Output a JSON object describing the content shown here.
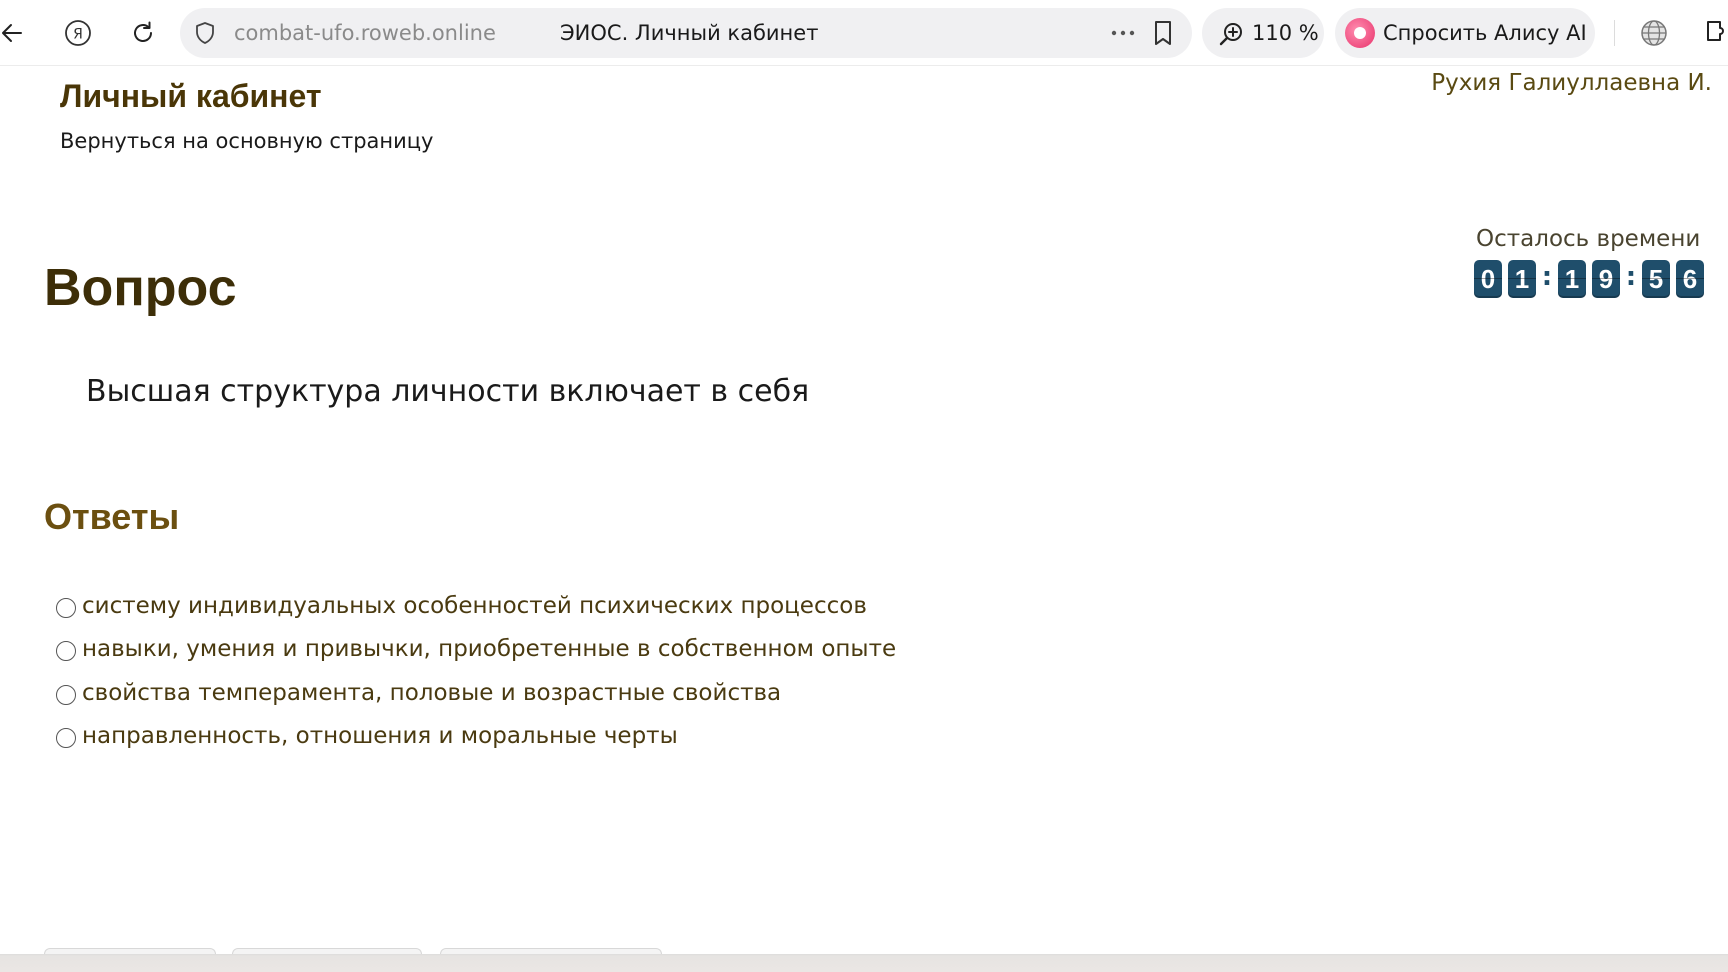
{
  "browser": {
    "url": "combat-ufo.roweb.online",
    "tab_title": "ЭИОС. Личный кабинет",
    "zoom": "110 %",
    "alice_label": "Спросить Алису AI"
  },
  "header": {
    "title": "Личный кабинет",
    "back_link": "Вернуться на основную страницу",
    "user_name": "Рухия Галиуллаевна И."
  },
  "timer": {
    "label": "Осталось времени",
    "digits": [
      "0",
      "1",
      "1",
      "9",
      "5",
      "6"
    ],
    "separator": ":"
  },
  "question": {
    "heading": "Вопрос",
    "text": "Высшая структура личности включает в себя"
  },
  "answers": {
    "heading": "Ответы",
    "items": [
      "систему индивидуальных особенностей психических процессов",
      "навыки, умения и привычки, приобретенные в собственном опыте",
      "свойства темперамента, половые и возрастные свойства",
      "направленность, отношения и моральные черты"
    ]
  }
}
